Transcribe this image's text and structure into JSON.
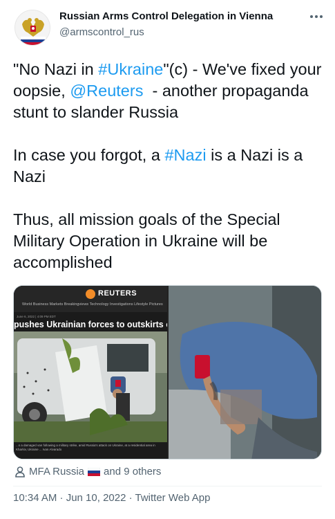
{
  "author": {
    "display_name": "Russian Arms Control Delegation in Vienna",
    "handle": "@armscontrol_rus",
    "avatar_icon": "double-headed-eagle-emblem-icon"
  },
  "more_icon": "more-options-icon",
  "tweet": {
    "p1_quote_open": "\"No Nazi in ",
    "p1_hashtag": "#Ukraine",
    "p1_after_hashtag": "\"(c) - We've fixed your oopsie, ",
    "p1_mention": "@Reuters",
    "p1_rest": "  - another propaganda stunt to slander Russia",
    "p2_before": "In case you forgot, a ",
    "p2_hashtag": "#Nazi",
    "p2_after": " is a Nazi is a Nazi",
    "p3": "Thus, all mission goals of the Special Military Operation in Ukraine will be accomplished"
  },
  "media": {
    "left_image": {
      "brand": "REUTERS",
      "nav_items": "World   Business   Markets   Breakingviews   Technology   Investigations   Lifestyle   Pictures",
      "date": "June 6, 2022 | 4:09 PM EDT",
      "headline": "pushes Ukrainian forces to outskirts of key easte",
      "caption": "...s a damaged van following a military strike, amid Russia's attack on Ukraine, at a residential area in Kharkiv, Ukraine ... Ivan Alvarado"
    }
  },
  "likes": {
    "person_icon": "person-icon",
    "liker": "MFA Russia",
    "flag": "russia-flag-icon",
    "others": "and 9 others"
  },
  "meta": {
    "timestamp": "10:34 AM · Jun 10, 2022 · Twitter Web App"
  },
  "colors": {
    "link": "#1d9bf0",
    "secondary_text": "#536471",
    "primary_text": "#0f1419"
  }
}
